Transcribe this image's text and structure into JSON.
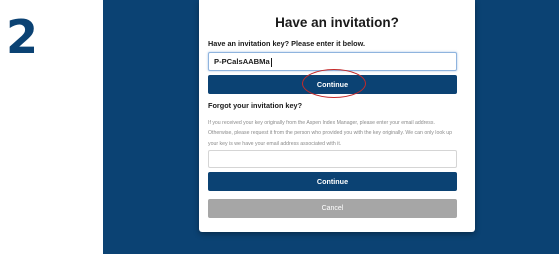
{
  "step": {
    "number": "2"
  },
  "dialog": {
    "title": "Have an invitation?",
    "key_prompt": "Have an invitation key? Please enter it below.",
    "key_input_value": "P-PCalsAABMa",
    "continue_label": "Continue",
    "forgot_heading": "Forgot your invitation key?",
    "help_text": "If you received your key originally from the Aspen Index Manager, please enter your email address. Otherwise, please request it from the person who provided you with the key originally. We can only look up your key is we have your email address associated with it.",
    "email_input_value": "",
    "continue_label_2": "Continue",
    "cancel_label": "Cancel"
  },
  "colors": {
    "brand_navy": "#0b4273",
    "annotation_red": "#c42a2a",
    "cancel_gray": "#a6a6a6"
  }
}
